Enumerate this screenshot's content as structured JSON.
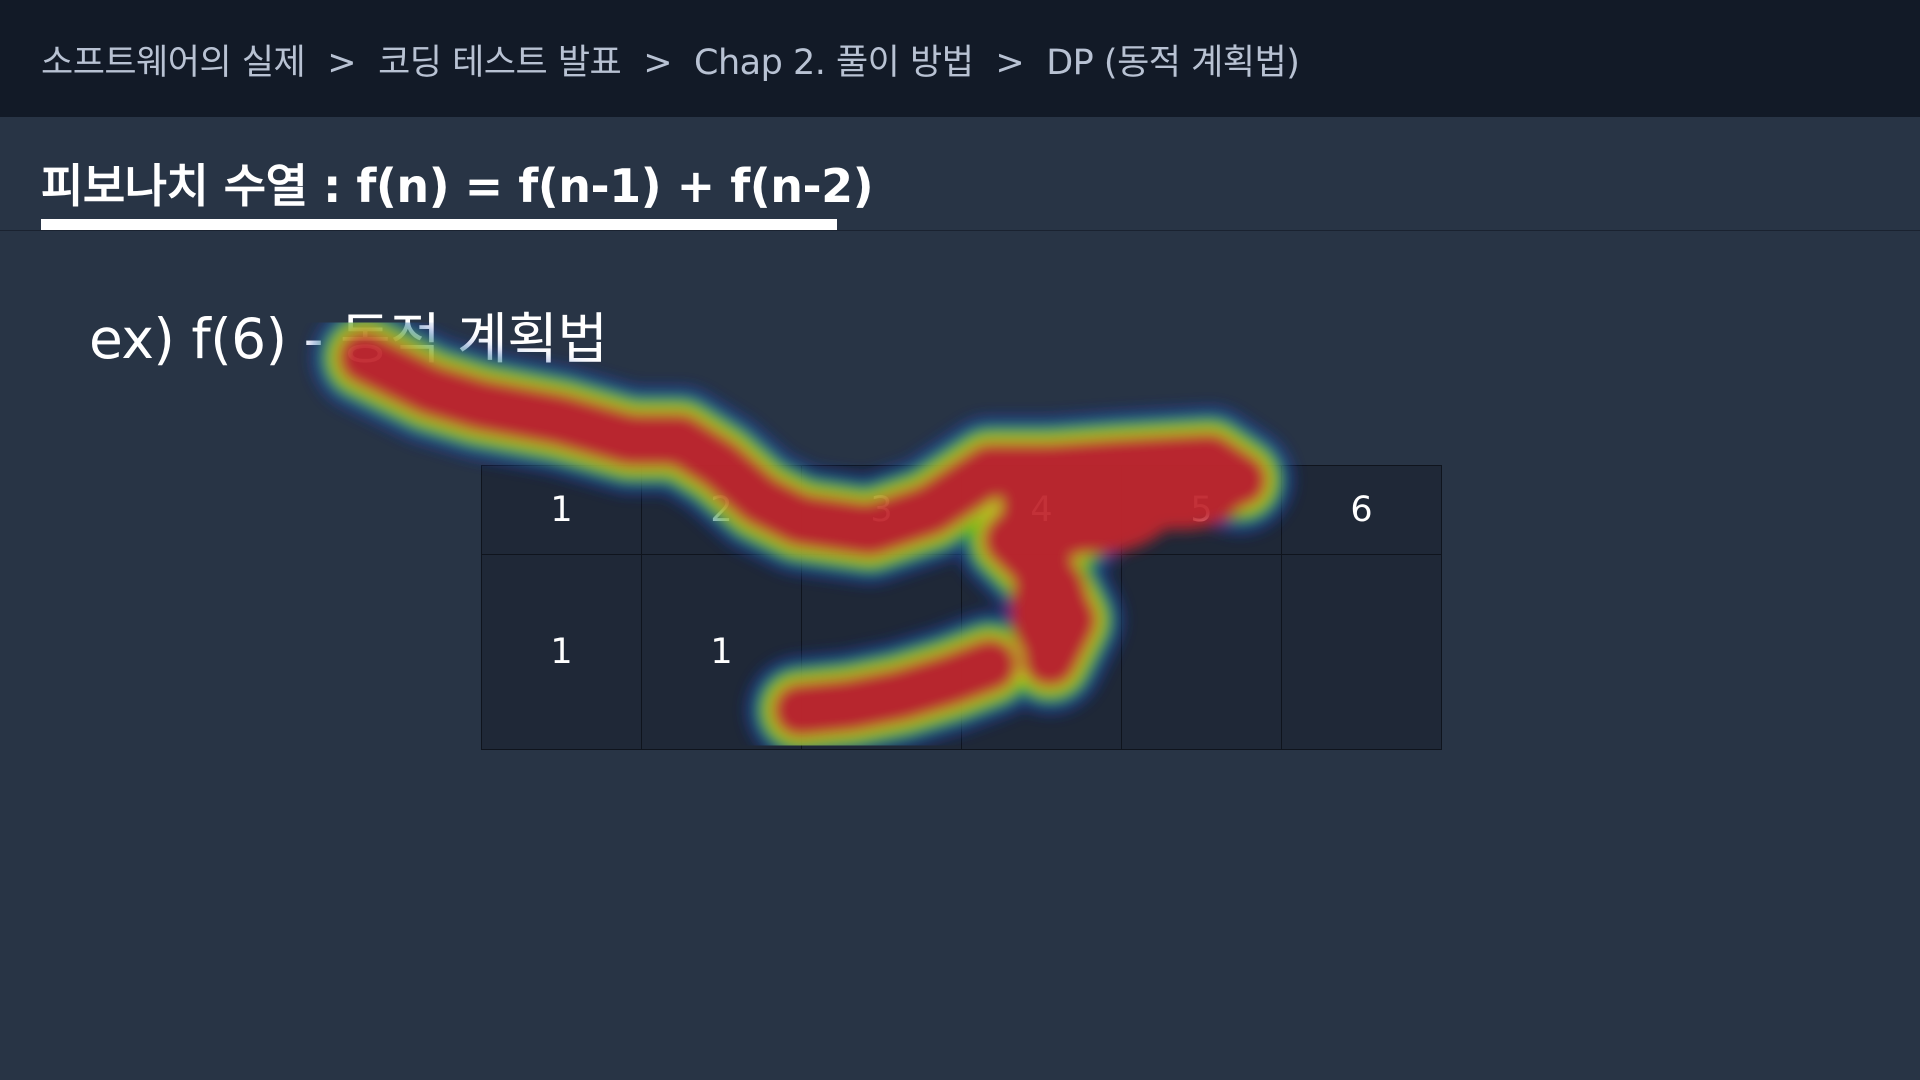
{
  "breadcrumb": {
    "items": [
      "소프트웨어의 실제",
      "코딩 테스트 발표",
      "Chap 2. 풀이 방법",
      "DP (동적 계획법)"
    ],
    "separator": ">"
  },
  "title": "피보나치 수열 : f(n) = f(n-1) + f(n-2)",
  "example_heading": "ex) f(6) - 동적 계획법",
  "table": {
    "indices": [
      "1",
      "2",
      "3",
      "4",
      "5",
      "6"
    ],
    "values": [
      "1",
      "1",
      "",
      "",
      "",
      ""
    ]
  },
  "colors": {
    "background": "#283445",
    "topbar": "#121a27",
    "table_cell": "#1f2837",
    "heat_hot": "#c0262e",
    "heat_mid": "#33cc00",
    "heat_cool": "#1e3cb4"
  }
}
